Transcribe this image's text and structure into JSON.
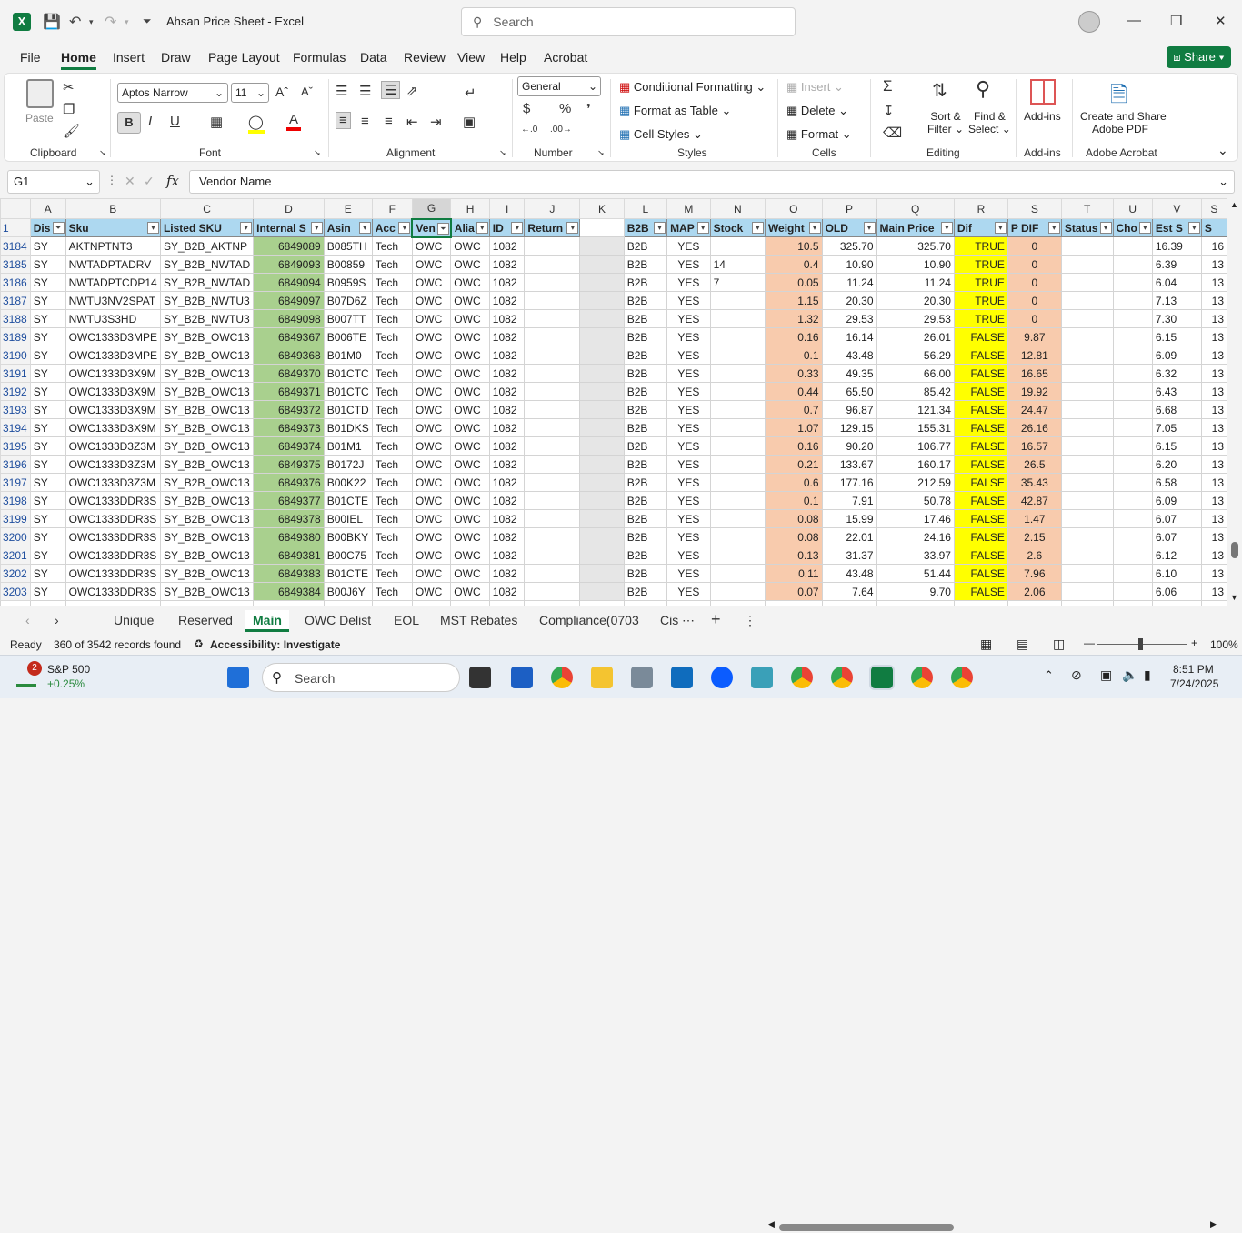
{
  "window": {
    "title": "Ahsan Price Sheet  -  Excel",
    "search_placeholder": "Search"
  },
  "menu": [
    "File",
    "Home",
    "Insert",
    "Draw",
    "Page Layout",
    "Formulas",
    "Data",
    "Review",
    "View",
    "Help",
    "Acrobat"
  ],
  "share_label": "Share",
  "ribbon": {
    "clipboard": {
      "paste": "Paste",
      "label": "Clipboard"
    },
    "font": {
      "name": "Aptos Narrow",
      "size": "11",
      "label": "Font"
    },
    "alignment": {
      "label": "Alignment"
    },
    "number": {
      "format": "General",
      "label": "Number"
    },
    "styles": {
      "cond": "Conditional Formatting",
      "table": "Format as Table",
      "cell": "Cell Styles",
      "label": "Styles"
    },
    "cells": {
      "insert": "Insert",
      "delete": "Delete",
      "format": "Format",
      "label": "Cells"
    },
    "editing": {
      "sort1": "Sort &",
      "sort2": "Filter",
      "find1": "Find &",
      "find2": "Select",
      "label": "Editing"
    },
    "addins": {
      "btn": "Add-ins",
      "label": "Add-ins"
    },
    "acrobat": {
      "btn1": "Create and Share",
      "btn2": "Adobe PDF",
      "label": "Adobe Acrobat"
    }
  },
  "formula": {
    "namebox": "G1",
    "content": "Vendor Name"
  },
  "columns": [
    "A",
    "B",
    "C",
    "D",
    "E",
    "F",
    "G",
    "H",
    "I",
    "J",
    "K",
    "L",
    "M",
    "N",
    "O",
    "P",
    "Q",
    "R",
    "S",
    "T",
    "U",
    "V",
    "S"
  ],
  "headers": [
    "Dis",
    "Sku",
    "Listed SKU",
    "Internal S",
    "Asin",
    "Acc",
    "Ven",
    "Alia",
    "ID",
    "Return",
    "",
    "B2B",
    "MAP",
    "Stock",
    "Weight",
    "OLD",
    "Main Price",
    "Dif",
    "P DIF",
    "Status",
    "Cho",
    "Est S",
    "S"
  ],
  "rows": [
    [
      "3184",
      "SY",
      "AKTNPTNT3",
      "SY_B2B_AKTNP",
      "6849089",
      "B085TH",
      "Tech",
      "OWC",
      "OWC",
      "1082",
      "",
      "",
      "B2B",
      "YES",
      "",
      "10.5",
      "325.70",
      "325.70",
      "TRUE",
      "0",
      "",
      "",
      "16.39",
      "16"
    ],
    [
      "3185",
      "SY",
      "NWTADPTADRV",
      "SY_B2B_NWTAD",
      "6849093",
      "B00859",
      "Tech",
      "OWC",
      "OWC",
      "1082",
      "",
      "",
      "B2B",
      "YES",
      "14",
      "0.4",
      "10.90",
      "10.90",
      "TRUE",
      "0",
      "",
      "",
      "6.39",
      "13"
    ],
    [
      "3186",
      "SY",
      "NWTADPTCDP14",
      "SY_B2B_NWTAD",
      "6849094",
      "B0959S",
      "Tech",
      "OWC",
      "OWC",
      "1082",
      "",
      "",
      "B2B",
      "YES",
      "7",
      "0.05",
      "11.24",
      "11.24",
      "TRUE",
      "0",
      "",
      "",
      "6.04",
      "13"
    ],
    [
      "3187",
      "SY",
      "NWTU3NV2SPAT",
      "SY_B2B_NWTU3",
      "6849097",
      "B07D6Z",
      "Tech",
      "OWC",
      "OWC",
      "1082",
      "",
      "",
      "B2B",
      "YES",
      "",
      "1.15",
      "20.30",
      "20.30",
      "TRUE",
      "0",
      "",
      "",
      "7.13",
      "13"
    ],
    [
      "3188",
      "SY",
      "NWTU3S3HD",
      "SY_B2B_NWTU3",
      "6849098",
      "B007TT",
      "Tech",
      "OWC",
      "OWC",
      "1082",
      "",
      "",
      "B2B",
      "YES",
      "",
      "1.32",
      "29.53",
      "29.53",
      "TRUE",
      "0",
      "",
      "",
      "7.30",
      "13"
    ],
    [
      "3189",
      "SY",
      "OWC1333D3MPE",
      "SY_B2B_OWC13",
      "6849367",
      "B006TE",
      "Tech",
      "OWC",
      "OWC",
      "1082",
      "",
      "",
      "B2B",
      "YES",
      "",
      "0.16",
      "16.14",
      "26.01",
      "FALSE",
      "9.87",
      "",
      "",
      "6.15",
      "13"
    ],
    [
      "3190",
      "SY",
      "OWC1333D3MPE",
      "SY_B2B_OWC13",
      "6849368",
      "B01M0",
      "Tech",
      "OWC",
      "OWC",
      "1082",
      "",
      "",
      "B2B",
      "YES",
      "",
      "0.1",
      "43.48",
      "56.29",
      "FALSE",
      "12.81",
      "",
      "",
      "6.09",
      "13"
    ],
    [
      "3191",
      "SY",
      "OWC1333D3X9M",
      "SY_B2B_OWC13",
      "6849370",
      "B01CTC",
      "Tech",
      "OWC",
      "OWC",
      "1082",
      "",
      "",
      "B2B",
      "YES",
      "",
      "0.33",
      "49.35",
      "66.00",
      "FALSE",
      "16.65",
      "",
      "",
      "6.32",
      "13"
    ],
    [
      "3192",
      "SY",
      "OWC1333D3X9M",
      "SY_B2B_OWC13",
      "6849371",
      "B01CTC",
      "Tech",
      "OWC",
      "OWC",
      "1082",
      "",
      "",
      "B2B",
      "YES",
      "",
      "0.44",
      "65.50",
      "85.42",
      "FALSE",
      "19.92",
      "",
      "",
      "6.43",
      "13"
    ],
    [
      "3193",
      "SY",
      "OWC1333D3X9M",
      "SY_B2B_OWC13",
      "6849372",
      "B01CTD",
      "Tech",
      "OWC",
      "OWC",
      "1082",
      "",
      "",
      "B2B",
      "YES",
      "",
      "0.7",
      "96.87",
      "121.34",
      "FALSE",
      "24.47",
      "",
      "",
      "6.68",
      "13"
    ],
    [
      "3194",
      "SY",
      "OWC1333D3X9M",
      "SY_B2B_OWC13",
      "6849373",
      "B01DKS",
      "Tech",
      "OWC",
      "OWC",
      "1082",
      "",
      "",
      "B2B",
      "YES",
      "",
      "1.07",
      "129.15",
      "155.31",
      "FALSE",
      "26.16",
      "",
      "",
      "7.05",
      "13"
    ],
    [
      "3195",
      "SY",
      "OWC1333D3Z3M",
      "SY_B2B_OWC13",
      "6849374",
      "B01M1",
      "Tech",
      "OWC",
      "OWC",
      "1082",
      "",
      "",
      "B2B",
      "YES",
      "",
      "0.16",
      "90.20",
      "106.77",
      "FALSE",
      "16.57",
      "",
      "",
      "6.15",
      "13"
    ],
    [
      "3196",
      "SY",
      "OWC1333D3Z3M",
      "SY_B2B_OWC13",
      "6849375",
      "B0172J",
      "Tech",
      "OWC",
      "OWC",
      "1082",
      "",
      "",
      "B2B",
      "YES",
      "",
      "0.21",
      "133.67",
      "160.17",
      "FALSE",
      "26.5",
      "",
      "",
      "6.20",
      "13"
    ],
    [
      "3197",
      "SY",
      "OWC1333D3Z3M",
      "SY_B2B_OWC13",
      "6849376",
      "B00K22",
      "Tech",
      "OWC",
      "OWC",
      "1082",
      "",
      "",
      "B2B",
      "YES",
      "",
      "0.6",
      "177.16",
      "212.59",
      "FALSE",
      "35.43",
      "",
      "",
      "6.58",
      "13"
    ],
    [
      "3198",
      "SY",
      "OWC1333DDR3S",
      "SY_B2B_OWC13",
      "6849377",
      "B01CTE",
      "Tech",
      "OWC",
      "OWC",
      "1082",
      "",
      "",
      "B2B",
      "YES",
      "",
      "0.1",
      "7.91",
      "50.78",
      "FALSE",
      "42.87",
      "",
      "",
      "6.09",
      "13"
    ],
    [
      "3199",
      "SY",
      "OWC1333DDR3S",
      "SY_B2B_OWC13",
      "6849378",
      "B00IEL",
      "Tech",
      "OWC",
      "OWC",
      "1082",
      "",
      "",
      "B2B",
      "YES",
      "",
      "0.08",
      "15.99",
      "17.46",
      "FALSE",
      "1.47",
      "",
      "",
      "6.07",
      "13"
    ],
    [
      "3200",
      "SY",
      "OWC1333DDR3S",
      "SY_B2B_OWC13",
      "6849380",
      "B00BKY",
      "Tech",
      "OWC",
      "OWC",
      "1082",
      "",
      "",
      "B2B",
      "YES",
      "",
      "0.08",
      "22.01",
      "24.16",
      "FALSE",
      "2.15",
      "",
      "",
      "6.07",
      "13"
    ],
    [
      "3201",
      "SY",
      "OWC1333DDR3S",
      "SY_B2B_OWC13",
      "6849381",
      "B00C75",
      "Tech",
      "OWC",
      "OWC",
      "1082",
      "",
      "",
      "B2B",
      "YES",
      "",
      "0.13",
      "31.37",
      "33.97",
      "FALSE",
      "2.6",
      "",
      "",
      "6.12",
      "13"
    ],
    [
      "3202",
      "SY",
      "OWC1333DDR3S",
      "SY_B2B_OWC13",
      "6849383",
      "B01CTE",
      "Tech",
      "OWC",
      "OWC",
      "1082",
      "",
      "",
      "B2B",
      "YES",
      "",
      "0.11",
      "43.48",
      "51.44",
      "FALSE",
      "7.96",
      "",
      "",
      "6.10",
      "13"
    ],
    [
      "3203",
      "SY",
      "OWC1333DDR3S",
      "SY_B2B_OWC13",
      "6849384",
      "B00J6Y",
      "Tech",
      "OWC",
      "OWC",
      "1082",
      "",
      "",
      "B2B",
      "YES",
      "",
      "0.07",
      "7.64",
      "9.70",
      "FALSE",
      "2.06",
      "",
      "",
      "6.06",
      "13"
    ]
  ],
  "sheets": [
    "Unique",
    "Reserved",
    "Main",
    "OWC Delist",
    "EOL",
    "MST Rebates",
    "Compliance(0703",
    "Cis"
  ],
  "status": {
    "ready": "Ready",
    "records": "360 of 3542 records found",
    "accessibility": "Accessibility: Investigate",
    "zoom": "100%"
  },
  "taskbar": {
    "stock_name": "S&P 500",
    "stock_change": "+0.25%",
    "badge": "2",
    "search": "Search",
    "time": "8:51 PM",
    "date": "7/24/2025"
  }
}
